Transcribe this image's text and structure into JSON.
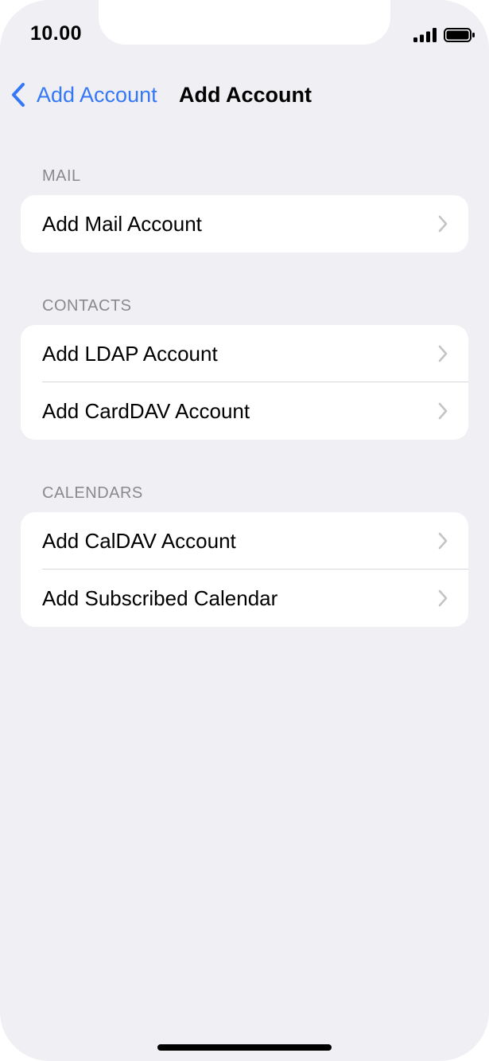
{
  "status_bar": {
    "time": "10.00",
    "icons": [
      "cellular-signal-icon",
      "battery-icon"
    ]
  },
  "nav": {
    "back_label": "Add Account",
    "title": "Add Account",
    "icons": [
      "chevron-left-icon"
    ]
  },
  "sections": {
    "mail": {
      "header": "MAIL",
      "rows": [
        "Add Mail Account"
      ]
    },
    "contacts": {
      "header": "CONTACTS",
      "rows": [
        "Add LDAP Account",
        "Add CardDAV Account"
      ]
    },
    "calendars": {
      "header": "CALENDARS",
      "rows": [
        "Add CalDAV Account",
        "Add Subscribed Calendar"
      ]
    }
  },
  "colors": {
    "accent": "#3478f6",
    "background": "#efeff4",
    "card": "#ffffff",
    "section_header": "#8a8a8e",
    "chevron": "#c4c4c7"
  }
}
